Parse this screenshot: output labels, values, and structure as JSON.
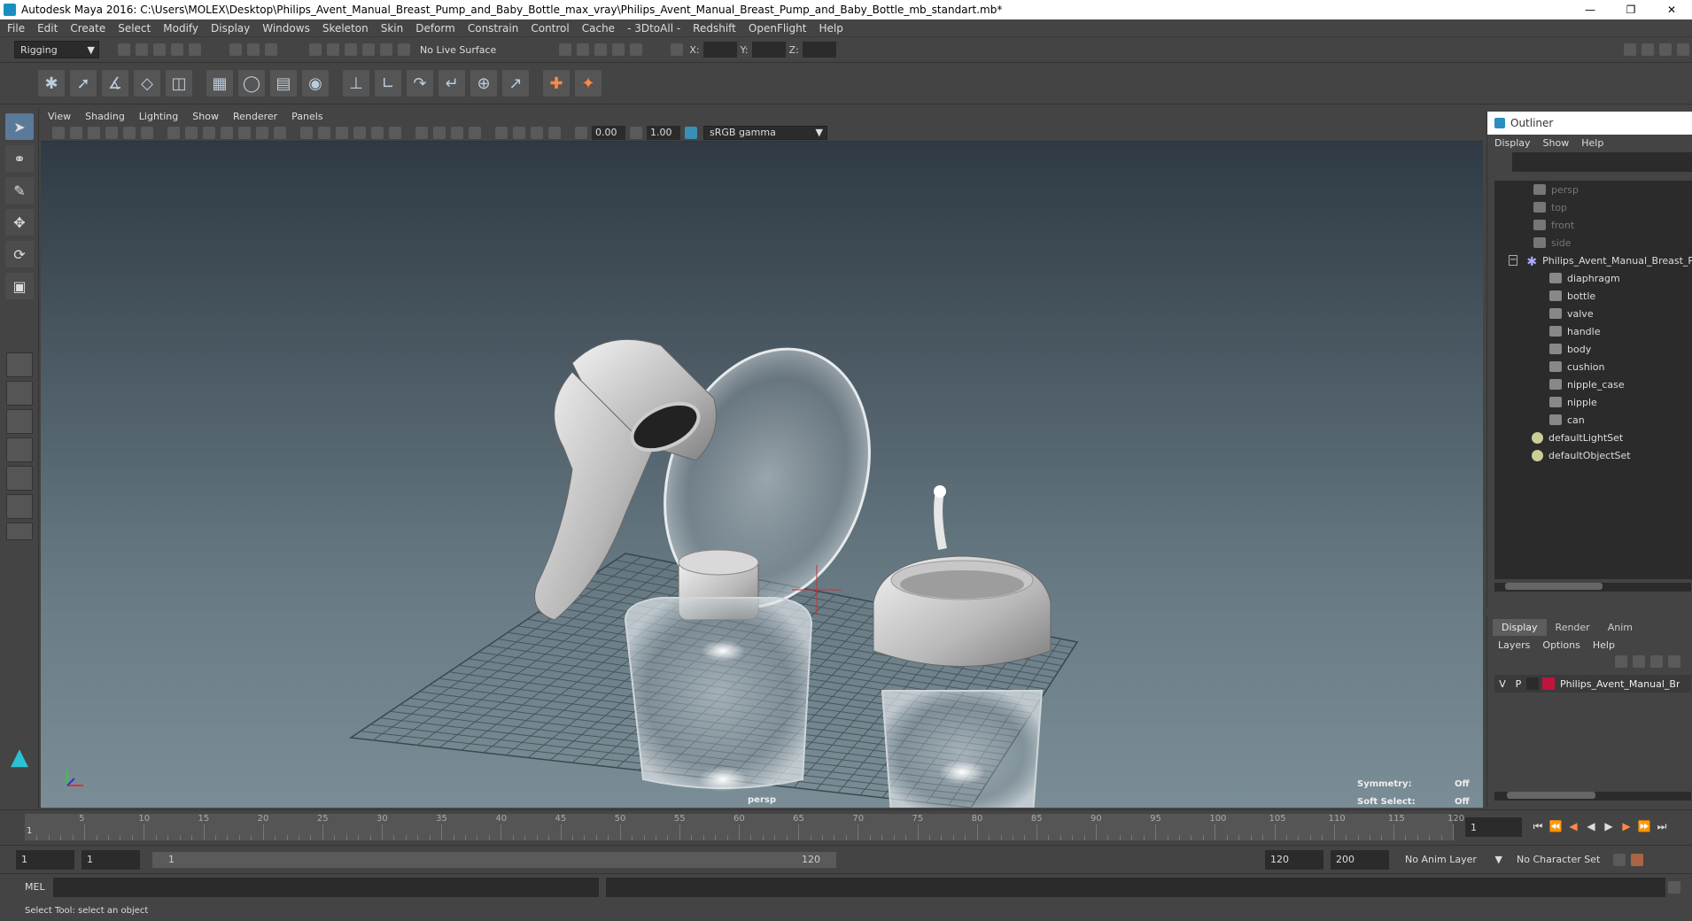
{
  "title": "Autodesk Maya 2016: C:\\Users\\MOLEX\\Desktop\\Philips_Avent_Manual_Breast_Pump_and_Baby_Bottle_max_vray\\Philips_Avent_Manual_Breast_Pump_and_Baby_Bottle_mb_standart.mb*",
  "menu": [
    "File",
    "Edit",
    "Create",
    "Select",
    "Modify",
    "Display",
    "Windows",
    "Skeleton",
    "Skin",
    "Deform",
    "Constrain",
    "Control",
    "Cache",
    "- 3DtoAll -",
    "Redshift",
    "OpenFlight",
    "Help"
  ],
  "status": {
    "menuset": "Rigging",
    "live_surface": "No Live Surface",
    "x_label": "X:",
    "y_label": "Y:",
    "z_label": "Z:"
  },
  "viewport": {
    "menu": [
      "View",
      "Shading",
      "Lighting",
      "Show",
      "Renderer",
      "Panels"
    ],
    "exposure": "0.00",
    "gamma": "1.00",
    "color_space": "sRGB gamma",
    "camera_label": "persp",
    "symmetry_label": "Symmetry:",
    "symmetry_value": "Off",
    "soft_select_label": "Soft Select:",
    "soft_select_value": "Off"
  },
  "outliner": {
    "title": "Outliner",
    "menu": [
      "Display",
      "Show",
      "Help"
    ],
    "cameras": [
      "persp",
      "top",
      "front",
      "side"
    ],
    "group": "Philips_Avent_Manual_Breast_Pu",
    "children": [
      "diaphragm",
      "bottle",
      "valve",
      "handle",
      "body",
      "cushion",
      "nipple_case",
      "nipple",
      "can"
    ],
    "sets": [
      "defaultLightSet",
      "defaultObjectSet"
    ]
  },
  "layers": {
    "tabs": [
      "Display",
      "Render",
      "Anim"
    ],
    "menu": [
      "Layers",
      "Options",
      "Help"
    ],
    "row": {
      "v": "V",
      "p": "P",
      "name": "Philips_Avent_Manual_Br",
      "color": "#c0143c"
    }
  },
  "timeline": {
    "ticks": [
      "5",
      "10",
      "15",
      "20",
      "25",
      "30",
      "35",
      "40",
      "45",
      "50",
      "55",
      "60",
      "65",
      "70",
      "75",
      "80",
      "85",
      "90",
      "95",
      "100",
      "105",
      "110",
      "115",
      "120"
    ],
    "start_marker": "1",
    "current_frame": "1"
  },
  "range": {
    "start": "1",
    "playback_start": "1",
    "slider_start": "1",
    "slider_end": "120",
    "playback_end": "120",
    "end": "200",
    "anim_layer": "No Anim Layer",
    "char_set": "No Character Set"
  },
  "mel_label": "MEL",
  "help_text": "Select Tool: select an object"
}
